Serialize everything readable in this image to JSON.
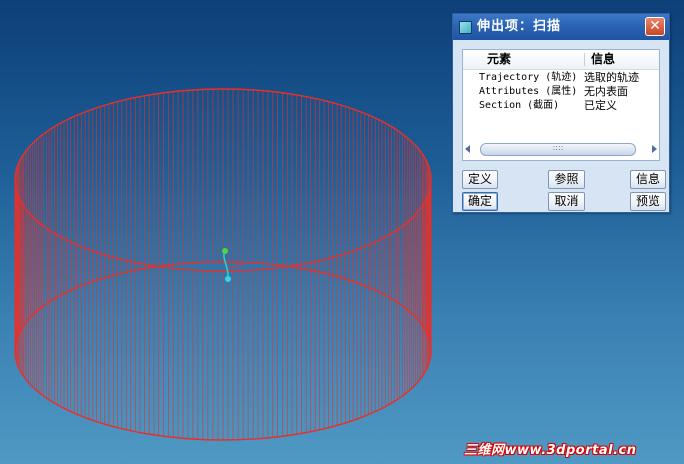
{
  "dialog": {
    "title": "伸出项：扫描",
    "close_label": "✕",
    "table": {
      "col_element": "元素",
      "col_info": "信息",
      "rows": [
        {
          "element": "Trajectory (轨迹)",
          "info": "选取的轨迹"
        },
        {
          "element": "Attributes (属性)",
          "info": "无内表面"
        },
        {
          "element": "Section (截面)",
          "info": "已定义"
        }
      ]
    },
    "scroll_grip": "::::",
    "buttons": {
      "define": "定义",
      "reference": "参照",
      "info": "信息",
      "ok": "确定",
      "cancel": "取消",
      "preview": "预览"
    }
  },
  "watermark": "三维网www.3dportal.cn",
  "colors": {
    "mesh": "#e8302a",
    "titlebar": "#2a62b2",
    "background_top": "#0d3f78",
    "background_bottom": "#4f99c4"
  },
  "icons": {
    "title": "dialog-window-icon",
    "close": "close-icon",
    "origin": "coordinate-triad-icon"
  }
}
